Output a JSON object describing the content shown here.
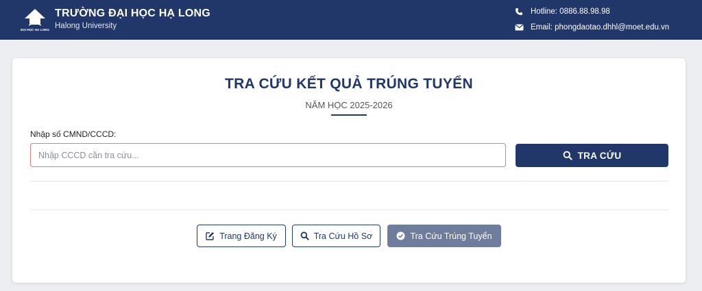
{
  "header": {
    "school_name": "TRƯỜNG ĐẠI HỌC HẠ LONG",
    "school_subname": "Halong University",
    "logo_text": "ĐẠI HỌC HẠ LONG",
    "hotline": "Hotline: 0886.88.98.98",
    "email": "Email: phongdaotao.dhhl@moet.edu.vn"
  },
  "main": {
    "title": "TRA CỨU KẾT QUẢ TRÚNG TUYỂN",
    "subtitle": "NĂM HỌC 2025-2026",
    "field_label": "Nhập số CMND/CCCD:",
    "search_placeholder": "Nhập CCCD cần tra cứu...",
    "search_value": "",
    "search_button": "TRA CỨU"
  },
  "nav": [
    {
      "label": "Trang Đăng Ký",
      "icon": "edit-icon",
      "active": false
    },
    {
      "label": "Tra Cứu Hồ Sơ",
      "icon": "search-icon",
      "active": false
    },
    {
      "label": "Tra Cứu Trúng Tuyển",
      "icon": "check-circle-icon",
      "active": true
    }
  ],
  "colors": {
    "primary": "#213669",
    "active_button": "#6f7c9b",
    "input_border": "#e07b7b",
    "page_background": "#eceef1"
  }
}
